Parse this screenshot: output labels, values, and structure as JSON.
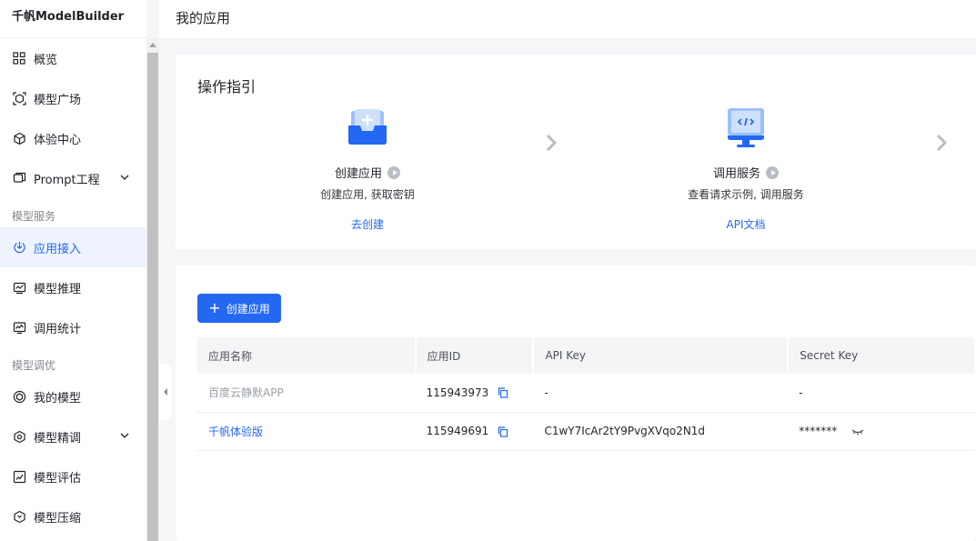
{
  "brand": "千帆ModelBuilder",
  "page_title": "我的应用",
  "sidebar": {
    "items_top": [
      {
        "label": "概览",
        "icon": "grid-icon"
      },
      {
        "label": "模型广场",
        "icon": "model-square-icon"
      },
      {
        "label": "体验中心",
        "icon": "cube-icon"
      },
      {
        "label": "Prompt工程",
        "icon": "prompt-icon",
        "expandable": true
      }
    ],
    "group_service": "模型服务",
    "items_service": [
      {
        "label": "应用接入",
        "icon": "app-access-icon",
        "active": true
      },
      {
        "label": "模型推理",
        "icon": "inference-icon"
      },
      {
        "label": "调用统计",
        "icon": "stats-icon"
      }
    ],
    "group_tuning": "模型调优",
    "items_tuning": [
      {
        "label": "我的模型",
        "icon": "my-model-icon"
      },
      {
        "label": "模型精调",
        "icon": "finetune-icon",
        "expandable": true
      },
      {
        "label": "模型评估",
        "icon": "evaluate-icon"
      },
      {
        "label": "模型压缩",
        "icon": "compress-icon"
      }
    ]
  },
  "guide": {
    "title": "操作指引",
    "steps": [
      {
        "title": "创建应用",
        "desc": "创建应用, 获取密钥",
        "link": "去创建"
      },
      {
        "title": "调用服务",
        "desc": "查看请求示例, 调用服务",
        "link": "API文档"
      }
    ]
  },
  "apps": {
    "create_button": "创建应用",
    "columns": [
      "应用名称",
      "应用ID",
      "API Key",
      "Secret Key"
    ],
    "rows": [
      {
        "name": "百度云静默APP",
        "id": "115943973",
        "api_key": "-",
        "secret_key": "-"
      },
      {
        "name": "千帆体验版",
        "id": "115949691",
        "api_key": "C1wY7IcAr2tY9PvgXVqo2N1d",
        "secret_key": "*******"
      }
    ]
  },
  "colors": {
    "accent": "#2468f2",
    "active_bg": "#eef3fe",
    "page_bg": "#f5f6f8"
  }
}
